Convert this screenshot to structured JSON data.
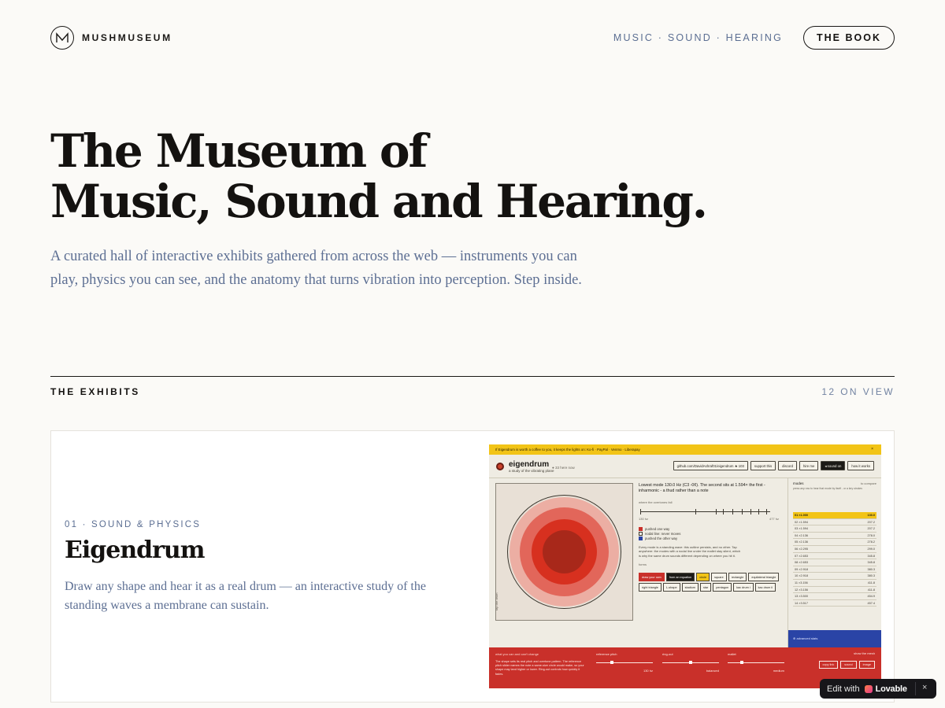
{
  "site": {
    "brand_name": "MUSHMUSEUM",
    "nav_topics": "MUSIC · SOUND · HEARING",
    "book_button": "THE BOOK"
  },
  "hero": {
    "title_line1": "The Museum of",
    "title_line2": "Music, Sound and Hearing.",
    "lede": "A curated hall of interactive exhibits gathered from across the web — instruments you can play, physics you can see, and the anatomy that turns vibration into perception. Step inside."
  },
  "exhibits": {
    "label": "THE EXHIBITS",
    "count": "12 ON VIEW",
    "items": [
      {
        "eyebrow": "01 · SOUND & PHYSICS",
        "title": "Eigendrum",
        "description": "Draw any shape and hear it as a real drum — an interactive study of the standing waves a membrane can sustain.",
        "preview": {
          "banner": "If Eigendrum is worth a coffee to you, it keeps the lights on: Ko-fi · PayPal · Venmo · Liberapay",
          "close": "×",
          "app_title": "eigendrum",
          "app_subtitle": "a study of the vibrating plane",
          "here_now": "● 33 here now",
          "toolbar_buttons": [
            "github.com/DavidAshraf01/eigendrum ★ 103",
            "support this",
            "discord",
            "hire me",
            "◂ sound on",
            "how it works"
          ],
          "canvas_label": "tap the drum",
          "headline": "Lowest mode 130.0 Hz (C3 -0¢). The second sits at 1.594× the first - inharmonic - a thud rather than a note",
          "overtones_label": "where the overtones fall",
          "axis_left": "130 hz",
          "axis_right": "477 hz",
          "legend": [
            "pushed one way",
            "nodal line: never moves",
            "pushed the other way"
          ],
          "explanation": "Every mode is a standing wave: this outline persists, and no other. Tap anywhere: the modes with a nodal line under the mallet stay silent, which is why the same drum sounds different depending on where you hit it.",
          "forms_label": "forms",
          "shapes": [
            "draw your own",
            "from an equation",
            "circle",
            "square",
            "rectangle",
            "equilateral triangle",
            "right triangle",
            "L-shape",
            "stadium",
            "star",
            "pentagon",
            "kac drum i",
            "kac drum ii"
          ],
          "modes_title": "modes",
          "modes_compare": "to compare",
          "modes_note": "press any row to hear that mode by itself - or a key strokes",
          "modes": [
            {
              "n": "01",
              "ratio": "×1.000",
              "hz": "130.0"
            },
            {
              "n": "02",
              "ratio": "×1.594",
              "hz": "207.2"
            },
            {
              "n": "03",
              "ratio": "×1.594",
              "hz": "207.2"
            },
            {
              "n": "04",
              "ratio": "×2.136",
              "hz": "278.0"
            },
            {
              "n": "05",
              "ratio": "×2.136",
              "hz": "278.2"
            },
            {
              "n": "06",
              "ratio": "×2.295",
              "hz": "299.0"
            },
            {
              "n": "07",
              "ratio": "×2.653",
              "hz": "345.8"
            },
            {
              "n": "08",
              "ratio": "×2.653",
              "hz": "345.8"
            },
            {
              "n": "09",
              "ratio": "×2.918",
              "hz": "380.3"
            },
            {
              "n": "10",
              "ratio": "×2.918",
              "hz": "380.3"
            },
            {
              "n": "11",
              "ratio": "×3.156",
              "hz": "411.8"
            },
            {
              "n": "12",
              "ratio": "×3.156",
              "hz": "411.8"
            },
            {
              "n": "13",
              "ratio": "×3.500",
              "hz": "454.9"
            },
            {
              "n": "14",
              "ratio": "×3.517",
              "hz": "457.4"
            }
          ],
          "advanced": "⊕ advanced stats",
          "bottom_heading": "what you can and can't change",
          "bottom_text": "The shape sets its real pitch and overtone pattern. The reference pitch slider names the note a same-size circle would make, so your shape may land higher or lower. Ring-out controls how quickly it fades.",
          "sliders": [
            {
              "label": "reference pitch",
              "value": "130 hz"
            },
            {
              "label": "ring-out",
              "value": "balanced"
            },
            {
              "label": "mallet",
              "value": "medium"
            }
          ],
          "show_mesh": "show the mesh",
          "bottom_buttons": [
            "copy link",
            "sound",
            "image"
          ]
        }
      }
    ]
  },
  "lovable": {
    "edit_with": "Edit with",
    "brand": "Lovable",
    "close": "×"
  },
  "colors": {
    "background": "#fbfaf7",
    "ink": "#141210",
    "muted_blue": "#5d6f93",
    "drum_red": "#c9302a",
    "drum_yellow": "#f2c417",
    "drum_blue": "#2a44a6"
  }
}
